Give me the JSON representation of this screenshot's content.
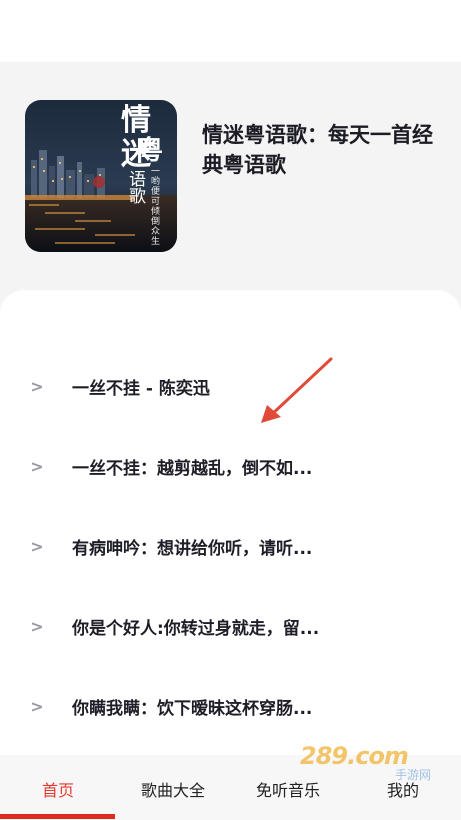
{
  "album": {
    "cover": {
      "title_line1": "情迷",
      "title_line2": "粤",
      "vertical_text": "语歌",
      "tagline": "一哟便可倾倒众生"
    },
    "title": "情迷粤语歌：每天一首经典粤语歌"
  },
  "songs": [
    {
      "arrow": ">",
      "title": "一丝不挂 - 陈奕迅"
    },
    {
      "arrow": ">",
      "title": "一丝不挂：越剪越乱，倒不如..."
    },
    {
      "arrow": ">",
      "title": "有病呻吟：想讲给你听，请听..."
    },
    {
      "arrow": ">",
      "title": "你是个好人:你转过身就走，留..."
    },
    {
      "arrow": ">",
      "title": "你瞒我瞒：饮下暧昧这杯穿肠..."
    }
  ],
  "tabbar": {
    "tabs": [
      {
        "label": "首页",
        "active": true
      },
      {
        "label": "歌曲大全",
        "active": false
      },
      {
        "label": "免听音乐",
        "active": false
      },
      {
        "label": "我的",
        "active": false
      }
    ]
  },
  "watermark": {
    "text": "289.com",
    "sub": "手游网"
  },
  "colors": {
    "accent": "#e02b20",
    "background_header": "#f4f4f5",
    "text_primary": "#1e1e28",
    "annotation_arrow": "#e04a38"
  },
  "icons": {
    "row_arrow": "chevron-right-icon",
    "annotation": "pointer-arrow-icon"
  }
}
